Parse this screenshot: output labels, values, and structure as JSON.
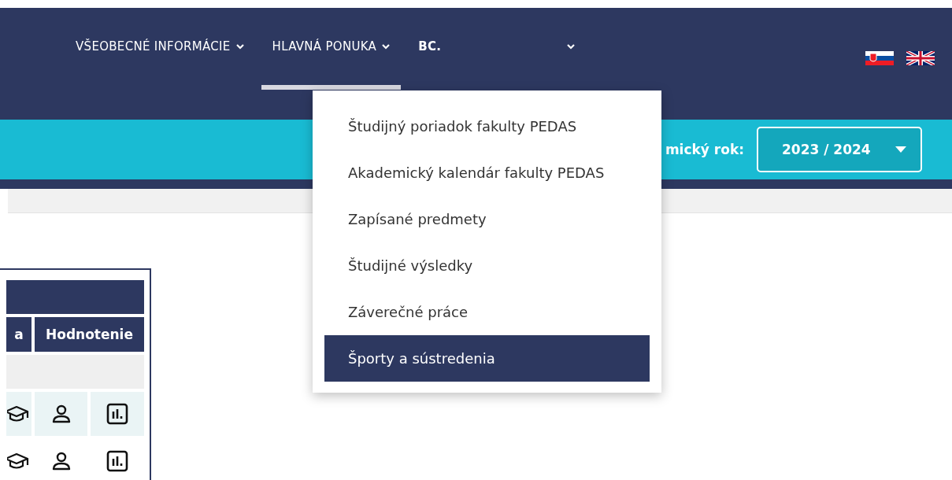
{
  "nav": [
    {
      "label": "VŠEOBECNÉ INFORMÁCIE",
      "selected": false,
      "kind": "caret"
    },
    {
      "label": "HLAVNÁ PONUKA",
      "selected": true,
      "kind": "caret"
    },
    {
      "label": "BC.",
      "selected": false,
      "kind": "far-caret"
    }
  ],
  "year_bar": {
    "label": "mický rok:",
    "value": "2023 / 2024"
  },
  "menu": [
    {
      "label": "Študijný poriadok fakulty PEDAS",
      "selected": false
    },
    {
      "label": "Akademický kalendár fakulty PEDAS",
      "selected": false
    },
    {
      "label": "Zapísané predmety",
      "selected": false
    },
    {
      "label": "Študijné výsledky",
      "selected": false
    },
    {
      "label": "Záverečné práce",
      "selected": false
    },
    {
      "label": "Športy a sústredenia",
      "selected": true
    }
  ],
  "table": {
    "columns": [
      "a",
      "Hodnotenie"
    ],
    "rows": [
      {
        "kind": "group"
      },
      {
        "kind": "icons"
      },
      {
        "kind": "icons"
      }
    ]
  }
}
